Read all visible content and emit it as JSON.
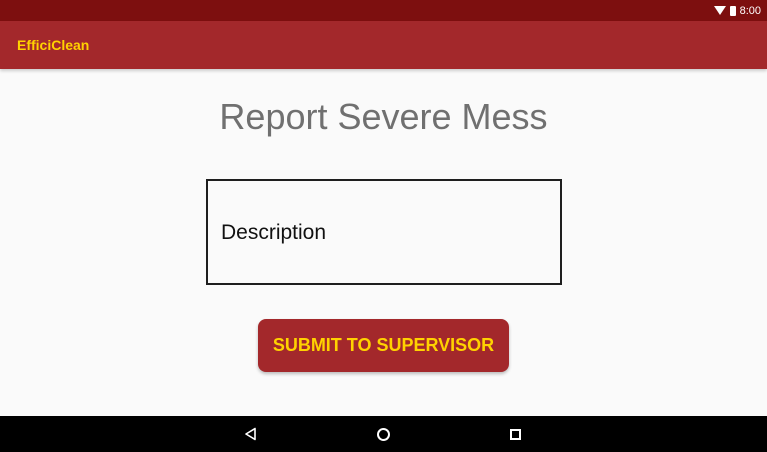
{
  "status_bar": {
    "time": "8:00",
    "icons": [
      "wifi-icon",
      "battery-icon"
    ]
  },
  "app_bar": {
    "title": "EfficiClean"
  },
  "main": {
    "title": "Report Severe Mess",
    "description_field": {
      "placeholder": "Description",
      "value": ""
    },
    "submit_label": "SUBMIT TO SUPERVISOR"
  },
  "nav_bar": {
    "icons": [
      "back-icon",
      "home-icon",
      "recents-icon"
    ]
  },
  "colors": {
    "status_bar": "#7d0f0f",
    "app_bar": "#a3282b",
    "accent_text": "#ffd200",
    "title_text": "#707070",
    "background": "#fafafa"
  }
}
